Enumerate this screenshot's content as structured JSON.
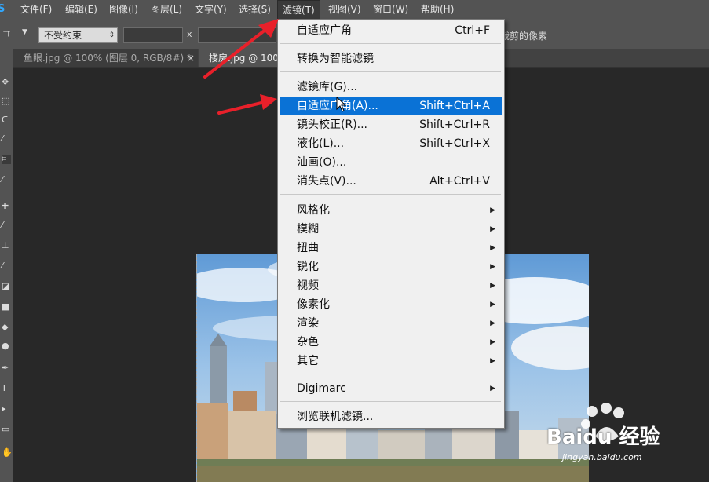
{
  "app": {
    "logo": "S"
  },
  "menubar": [
    "文件(F)",
    "编辑(E)",
    "图像(I)",
    "图层(L)",
    "文字(Y)",
    "选择(S)",
    "滤镜(T)",
    "视图(V)",
    "窗口(W)",
    "帮助(H)"
  ],
  "options": {
    "ratio_value": "不受约束",
    "x_label": "x",
    "delete_cropped": "裁剪的像素"
  },
  "tabs": [
    {
      "label": "鱼眼.jpg @ 100% (图层 0, RGB/8#) *",
      "close": "×"
    },
    {
      "label": "楼房.jpg @ 100%"
    }
  ],
  "filter_menu": {
    "items": [
      {
        "label": "自适应广角",
        "shortcut": "Ctrl+F"
      },
      {
        "label": "转换为智能滤镜",
        "shortcut": ""
      },
      {
        "label": "滤镜库(G)...",
        "shortcut": ""
      },
      {
        "label": "自适应广角(A)...",
        "shortcut": "Shift+Ctrl+A",
        "highlighted": true
      },
      {
        "label": "镜头校正(R)...",
        "shortcut": "Shift+Ctrl+R"
      },
      {
        "label": "液化(L)...",
        "shortcut": "Shift+Ctrl+X"
      },
      {
        "label": "油画(O)...",
        "shortcut": ""
      },
      {
        "label": "消失点(V)...",
        "shortcut": "Alt+Ctrl+V"
      }
    ],
    "submenus": [
      "风格化",
      "模糊",
      "扭曲",
      "锐化",
      "视频",
      "像素化",
      "渲染",
      "杂色",
      "其它"
    ],
    "digimarc": "Digimarc",
    "browse": "浏览联机滤镜...",
    "submenu_arrow": "▶"
  },
  "watermark": {
    "brand": "Baidu 经验",
    "url": "jingyan.baidu.com"
  },
  "colors": {
    "accent": "#0a72d6",
    "annotation_arrow": "#e8202a"
  }
}
